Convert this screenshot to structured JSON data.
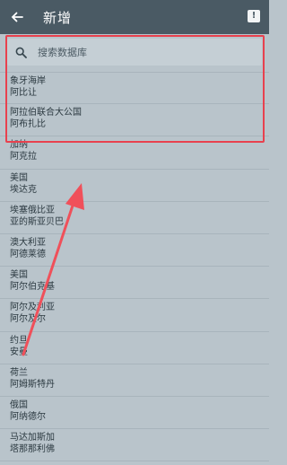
{
  "app_bar": {
    "title": "新增",
    "back_icon": "arrow-left-icon",
    "feedback_icon": "feedback-icon",
    "feedback_glyph": "!"
  },
  "search": {
    "placeholder": "搜索数据库",
    "value": ""
  },
  "countries": [
    {
      "line1": "象牙海岸",
      "line2": "阿比让"
    },
    {
      "line1": "阿拉伯联合大公国",
      "line2": "阿布扎比"
    },
    {
      "line1": "加纳",
      "line2": "阿克拉"
    },
    {
      "line1": "美国",
      "line2": "埃达克"
    },
    {
      "line1": "埃塞俄比亚",
      "line2": "亚的斯亚贝巴"
    },
    {
      "line1": "澳大利亚",
      "line2": "阿德莱德"
    },
    {
      "line1": "美国",
      "line2": "阿尔伯克基"
    },
    {
      "line1": "阿尔及利亚",
      "line2": "阿尔及尔"
    },
    {
      "line1": "约旦",
      "line2": "安曼"
    },
    {
      "line1": "荷兰",
      "line2": "阿姆斯特丹"
    },
    {
      "line1": "俄国",
      "line2": "阿纳德尔"
    },
    {
      "line1": "马达加斯加",
      "line2": "塔那那利佛"
    }
  ],
  "annotation": {
    "highlight_color": "#e8414e",
    "arrow_color": "#f0505a"
  }
}
